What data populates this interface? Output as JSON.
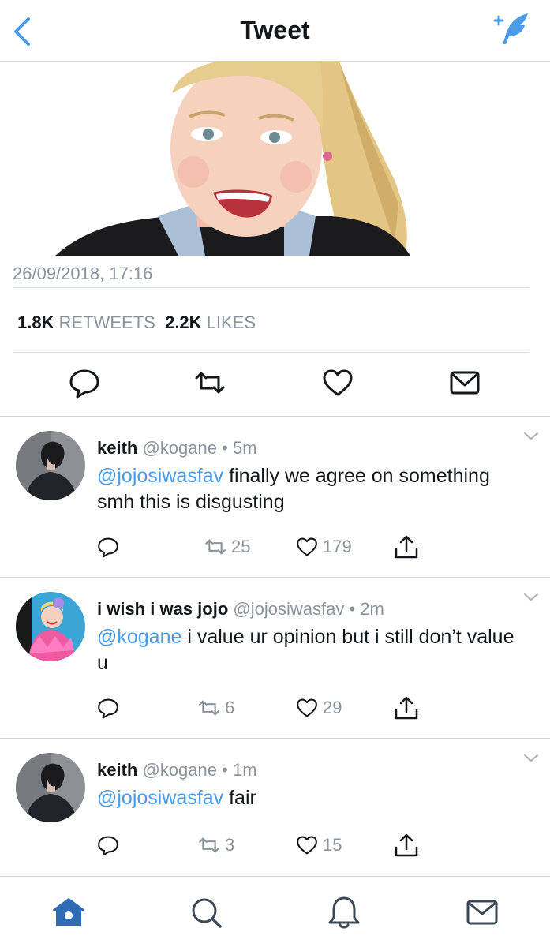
{
  "header": {
    "title": "Tweet"
  },
  "tweet": {
    "timestamp": "26/09/2018, 17:16",
    "retweets_count": "1.8K",
    "retweets_label": "RETWEETS",
    "likes_count": "2.2K",
    "likes_label": "LIKES"
  },
  "replies": [
    {
      "name": "keith",
      "handle": "@kogane",
      "dot": "•",
      "time": "5m",
      "mention": "@jojosiwasfav",
      "text": " finally we agree on something smh this is disgusting",
      "retweets": "25",
      "likes": "179"
    },
    {
      "name": "i wish i was jojo",
      "handle": "@jojosiwasfav",
      "dot": "•",
      "time": "2m",
      "mention": "@kogane",
      "text": " i value ur opinion but i still don’t value u",
      "retweets": "6",
      "likes": "29"
    },
    {
      "name": "keith",
      "handle": "@kogane",
      "dot": "•",
      "time": "1m",
      "mention": "@jojosiwasfav",
      "text": " fair",
      "retweets": "3",
      "likes": "15"
    }
  ],
  "colors": {
    "accent": "#4a9be8",
    "text": "#14171a",
    "muted": "#8a939b",
    "nav_active": "#2f6cb5"
  }
}
